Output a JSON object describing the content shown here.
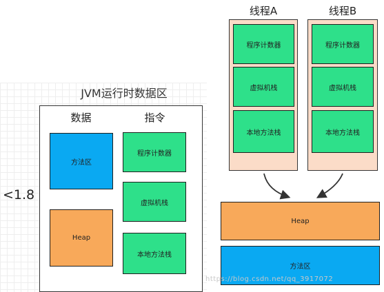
{
  "left": {
    "title": "JVM运行时数据区",
    "version_label": "<1.8",
    "column_data": "数据",
    "column_instr": "指令",
    "method_area": "方法区",
    "heap": "Heap",
    "pc_register": "程序计数器",
    "vm_stack": "虚拟机栈",
    "native_stack": "本地方法栈"
  },
  "right": {
    "thread_a": {
      "title": "线程A",
      "pc_register": "程序计数器",
      "vm_stack": "虚拟机栈",
      "native_stack": "本地方法栈"
    },
    "thread_b": {
      "title": "线程B",
      "pc_register": "程序计数器",
      "vm_stack": "虚拟机栈",
      "native_stack": "本地方法栈"
    },
    "heap": "Heap",
    "method_area": "方法区"
  },
  "watermark": "https://blog.csdn.net/qq_3917072",
  "colors": {
    "green": "#2ee08a",
    "blue": "#0aa9f2",
    "orange": "#f8a95a",
    "thread_bg": "#fbdcc8"
  }
}
